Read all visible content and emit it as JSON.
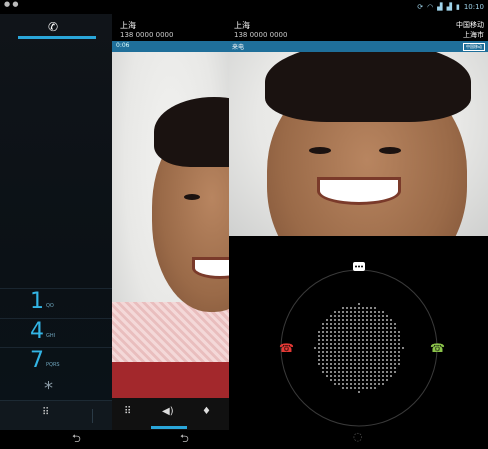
{
  "status_bar": {
    "left_text": "● ●",
    "time": "10:10"
  },
  "dialer": {
    "tab_icon": "phone-icon",
    "keys": [
      {
        "digit": "1",
        "letters": "QO"
      },
      {
        "digit": "4",
        "letters": "GHI"
      },
      {
        "digit": "7",
        "letters": "PQRS"
      }
    ],
    "star": "*"
  },
  "calls": [
    {
      "name": "上海",
      "number": "138 0000 0000"
    },
    {
      "name": "上海",
      "number": "138 0000 0000"
    }
  ],
  "carrier": {
    "name": "中国移动",
    "location": "上海市"
  },
  "progress": {
    "time": "0:06",
    "label": "来电",
    "badge": "中国移动"
  },
  "colors": {
    "accent": "#33b5e5",
    "decline": "#e53935",
    "answer": "#8bc34a",
    "hold_red": "#a3282c"
  }
}
